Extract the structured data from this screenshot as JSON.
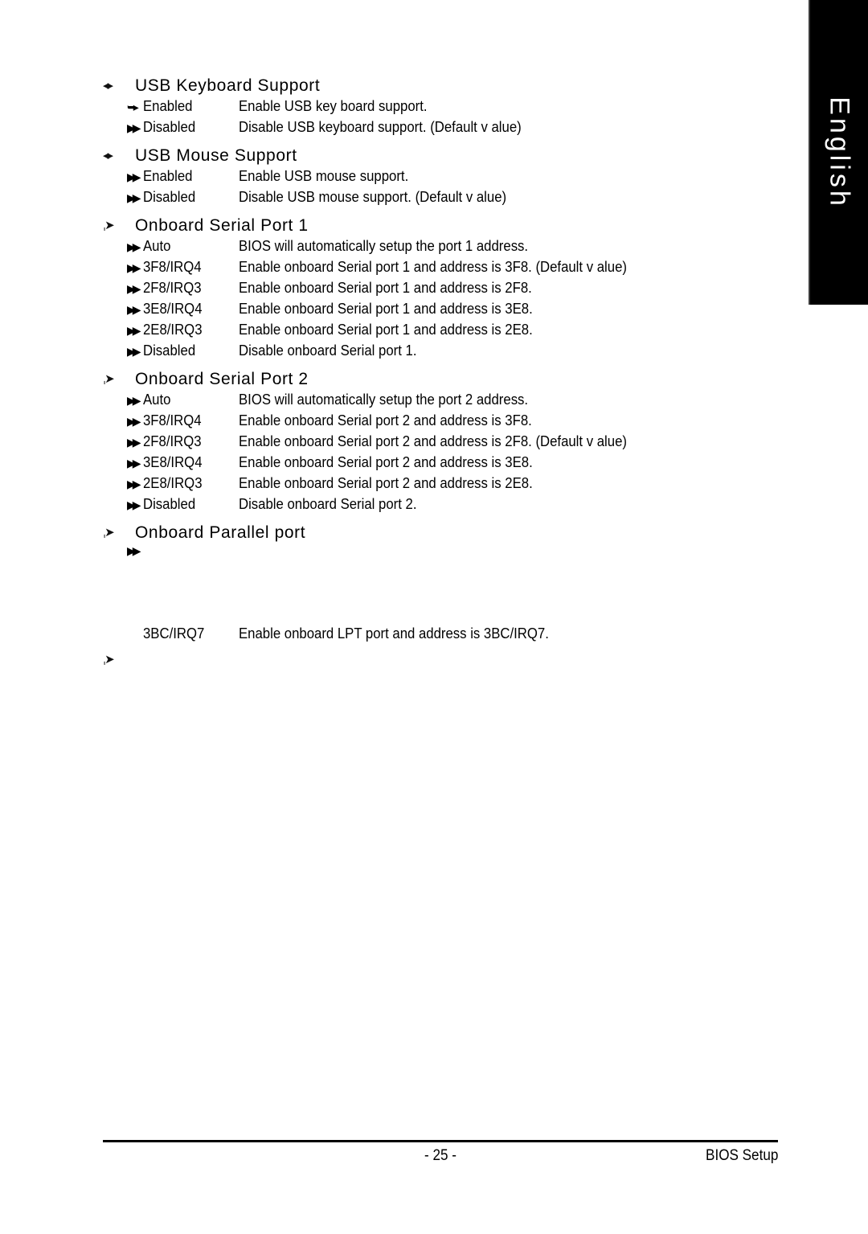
{
  "language_tab": {
    "label": "English",
    "background_color": "#000000",
    "text_color": "#ffffff"
  },
  "markers": {
    "section": "◂▸",
    "section_alt": "ˌ➤",
    "option": "▶▶",
    "option_alt": "➥▸"
  },
  "sections": [
    {
      "id": "usb-keyboard-support",
      "marker": "◂▸",
      "title": "USB Keyboard Support",
      "options": [
        {
          "marker": "➥▸",
          "label": "Enabled",
          "desc": "Enable USB key board support."
        },
        {
          "marker": "▶▶",
          "label": "Disabled",
          "desc": "Disable USB keyboard support. (Default v alue)"
        }
      ]
    },
    {
      "id": "usb-mouse-support",
      "marker": "◂▸",
      "title": "USB Mouse Support",
      "options": [
        {
          "marker": "▶▶",
          "label": "Enabled",
          "desc": "Enable USB mouse support."
        },
        {
          "marker": "▶▶",
          "label": "Disabled",
          "desc": "Disable USB mouse support. (Default v alue)"
        }
      ]
    },
    {
      "id": "onboard-serial-port-1",
      "marker": "ˌ➤",
      "title": "Onboard Serial Port 1",
      "options": [
        {
          "marker": "▶▶",
          "label": "Auto",
          "desc": "BIOS will automatically setup the port 1 address."
        },
        {
          "marker": "▶▶",
          "label": "3F8/IRQ4",
          "desc": "Enable onboard Serial port 1 and address is 3F8. (Default v alue)"
        },
        {
          "marker": "▶▶",
          "label": "2F8/IRQ3",
          "desc": "Enable onboard Serial port 1 and address is 2F8."
        },
        {
          "marker": "▶▶",
          "label": "3E8/IRQ4",
          "desc": "Enable onboard Serial port 1 and address is 3E8."
        },
        {
          "marker": "▶▶",
          "label": "2E8/IRQ3",
          "desc": "Enable onboard Serial port 1 and address is 2E8."
        },
        {
          "marker": "▶▶",
          "label": "Disabled",
          "desc": "Disable onboard Serial port 1."
        }
      ]
    },
    {
      "id": "onboard-serial-port-2",
      "marker": "ˌ➤",
      "title": "Onboard Serial Port 2",
      "options": [
        {
          "marker": "▶▶",
          "label": "Auto",
          "desc": "BIOS will automatically setup the port 2 address."
        },
        {
          "marker": "▶▶",
          "label": "3F8/IRQ4",
          "desc": "Enable onboard Serial port 2 and address is 3F8."
        },
        {
          "marker": "▶▶",
          "label": "2F8/IRQ3",
          "desc": "Enable onboard Serial port 2 and address is 2F8. (Default v alue)"
        },
        {
          "marker": "▶▶",
          "label": "3E8/IRQ4",
          "desc": "Enable onboard Serial port 2 and address is 3E8."
        },
        {
          "marker": "▶▶",
          "label": "2E8/IRQ3",
          "desc": "Enable onboard Serial port 2 and address is 2E8."
        },
        {
          "marker": "▶▶",
          "label": "Disabled",
          "desc": "Disable onboard Serial port 2."
        }
      ]
    },
    {
      "id": "onboard-parallel-port",
      "marker": "ˌ➤",
      "title": "Onboard Parallel port",
      "options": [
        {
          "marker": "▶▶",
          "label": "",
          "desc": ""
        },
        {
          "marker": "",
          "label": "3BC/IRQ7",
          "desc": "Enable onboard LPT port and address is 3BC/IRQ7."
        }
      ]
    }
  ],
  "trailing_marker": "ˌ➤",
  "footer": {
    "page_number": "- 25 -",
    "label": "BIOS Setup"
  }
}
